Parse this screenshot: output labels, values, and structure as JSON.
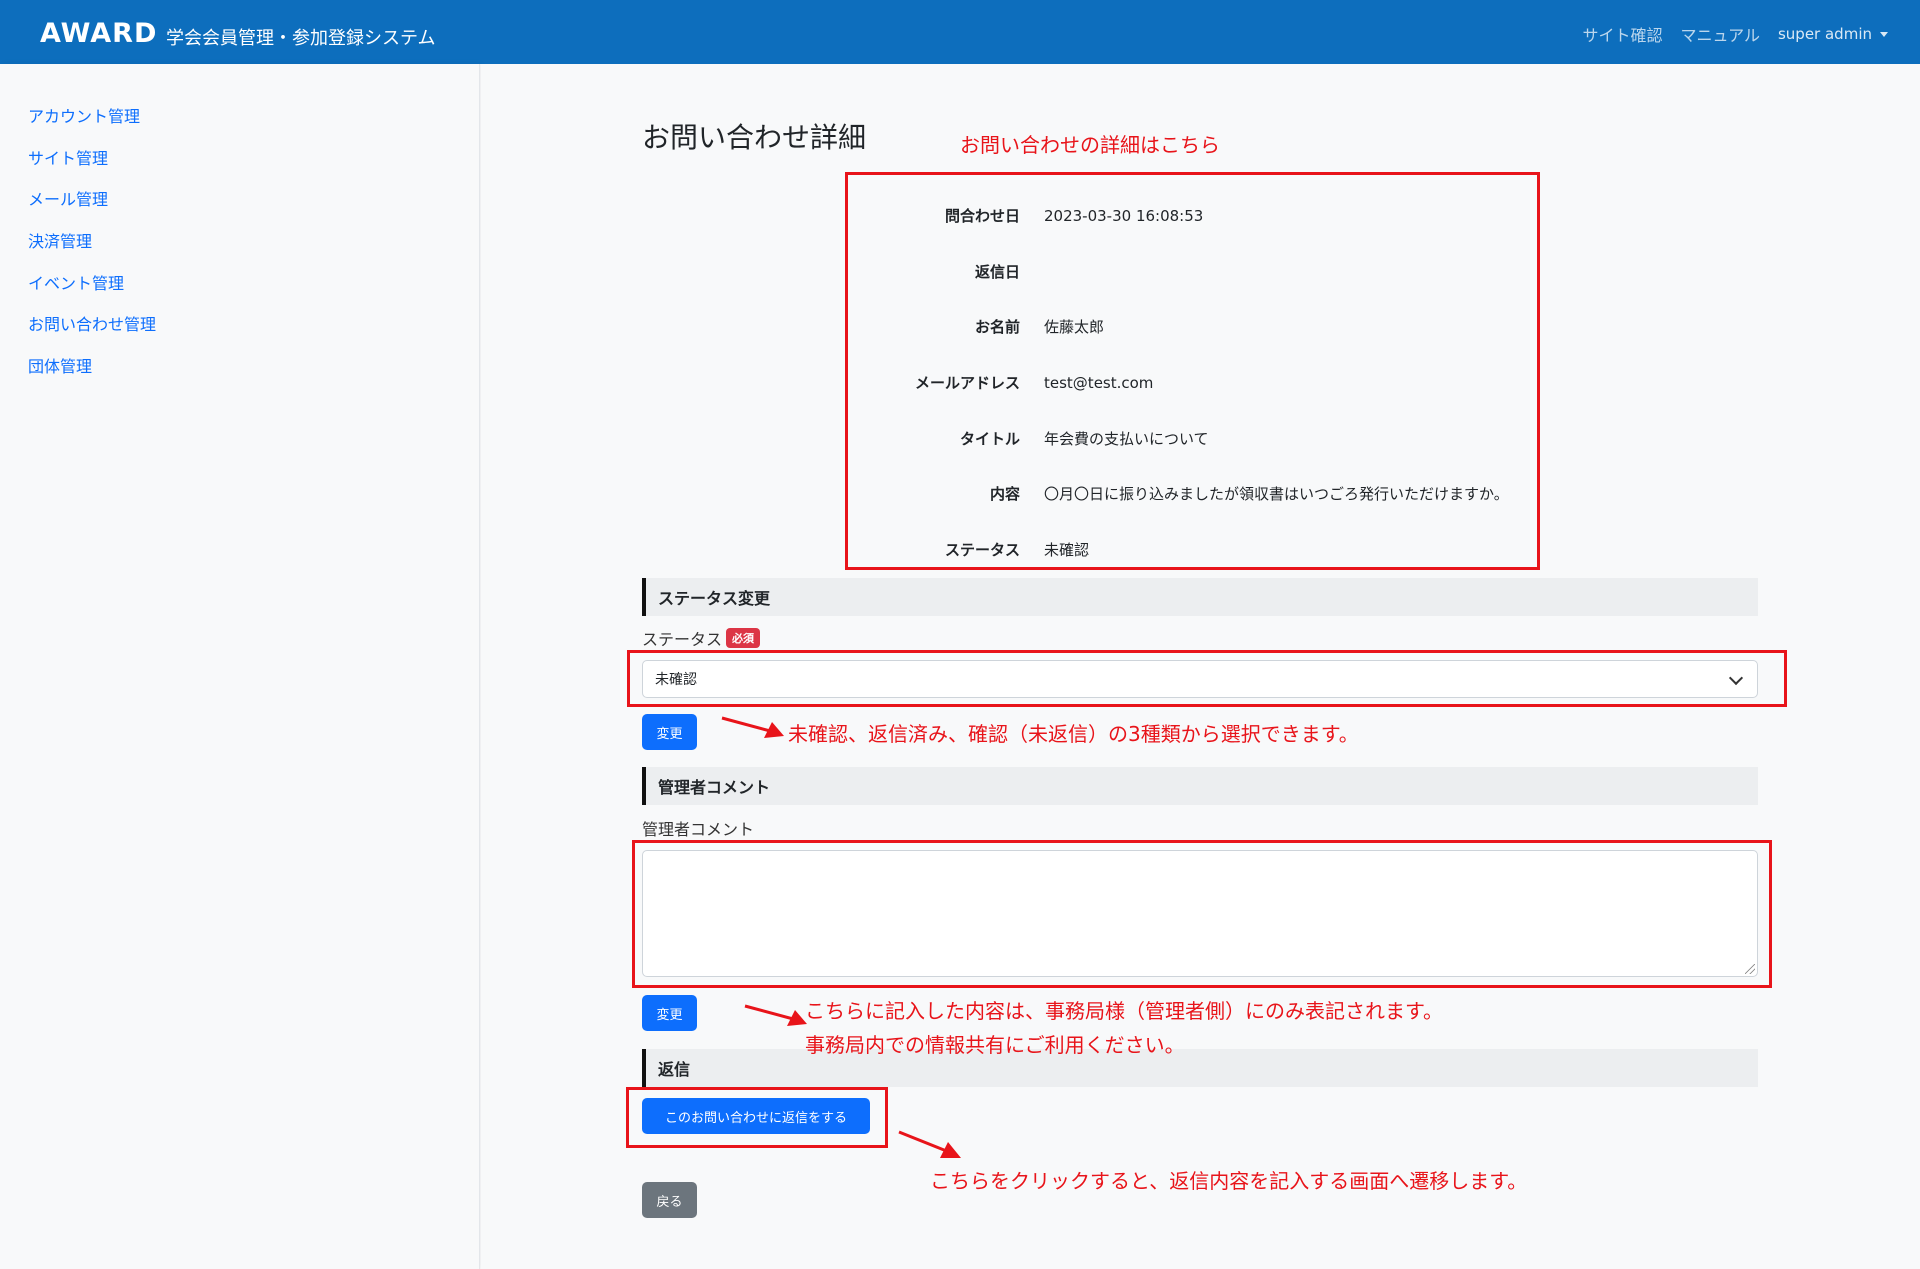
{
  "header": {
    "logo": "AWARD",
    "app_title": "学会会員管理・参加登録システム",
    "nav": {
      "site_check": "サイト確認",
      "manual": "マニュアル",
      "user": "super admin"
    }
  },
  "sidebar": {
    "items": [
      {
        "label": "アカウント管理"
      },
      {
        "label": "サイト管理"
      },
      {
        "label": "メール管理"
      },
      {
        "label": "決済管理"
      },
      {
        "label": "イベント管理"
      },
      {
        "label": "お問い合わせ管理"
      },
      {
        "label": "団体管理"
      }
    ]
  },
  "page": {
    "title": "お問い合わせ詳細"
  },
  "details": [
    {
      "label": "問合わせ日",
      "value": "2023-03-30 16:08:53"
    },
    {
      "label": "返信日",
      "value": ""
    },
    {
      "label": "お名前",
      "value": "佐藤太郎"
    },
    {
      "label": "メールアドレス",
      "value": "test@test.com"
    },
    {
      "label": "タイトル",
      "value": "年会費の支払いについて"
    },
    {
      "label": "内容",
      "value": "〇月〇日に振り込みましたが領収書はいつごろ発行いただけますか。"
    },
    {
      "label": "ステータス",
      "value": "未確認"
    }
  ],
  "status_section": {
    "heading": "ステータス変更",
    "field_label": "ステータス",
    "required_badge": "必須",
    "selected": "未確認",
    "button": "変更"
  },
  "comment_section": {
    "heading": "管理者コメント",
    "field_label": "管理者コメント",
    "value": "",
    "button": "変更"
  },
  "reply_section": {
    "heading": "返信",
    "button": "このお問い合わせに返信をする"
  },
  "back_button": "戻る",
  "annotations": {
    "details_note": "お問い合わせの詳細はこちら",
    "status_note": "未確認、返信済み、確認（未返信）の3種類から選択できます。",
    "comment_note_1": "こちらに記入した内容は、事務局様（管理者側）にのみ表記されます。",
    "comment_note_2": "事務局内での情報共有にご利用ください。",
    "reply_note": "こちらをクリックすると、返信内容を記入する画面へ遷移します。"
  },
  "colors": {
    "header": "#0d6ebd",
    "primary": "#0d6efd",
    "annotation": "#e8141a",
    "badge": "#dc3545"
  }
}
